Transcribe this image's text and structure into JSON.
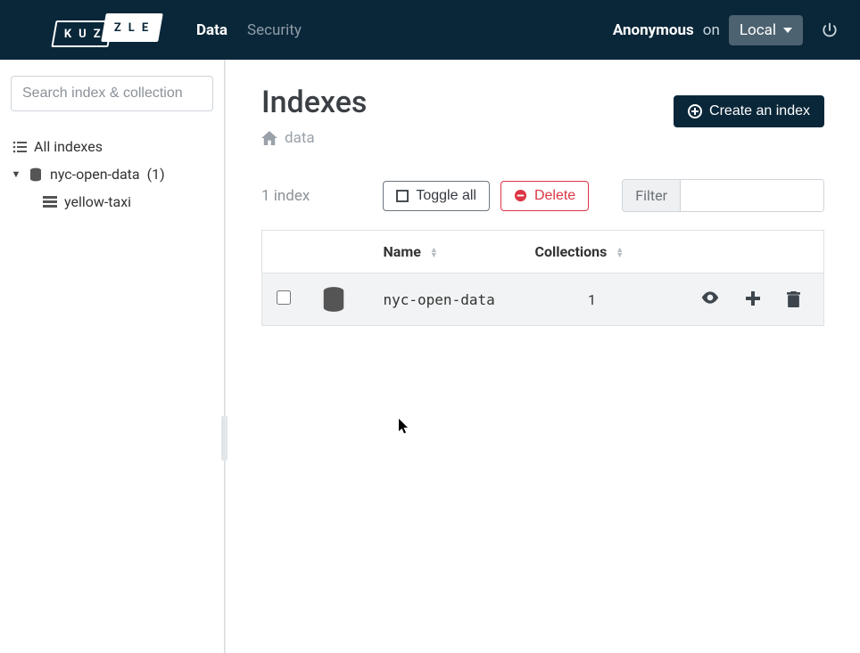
{
  "brand": {
    "left": "KUZ",
    "right": "ZLE"
  },
  "nav": {
    "data": "Data",
    "security": "Security"
  },
  "user": {
    "name": "Anonymous",
    "on": "on"
  },
  "env": {
    "label": "Local"
  },
  "sidebar": {
    "search_placeholder": "Search index & collection",
    "all_label": "All indexes",
    "index": {
      "name": "nyc-open-data",
      "count_suffix": "(1)"
    },
    "collection": {
      "name": "yellow-taxi"
    }
  },
  "page": {
    "title": "Indexes",
    "breadcrumb": "data",
    "create_label": "Create an index"
  },
  "toolbar": {
    "count": "1 index",
    "toggle_all": "Toggle all",
    "delete": "Delete",
    "filter_label": "Filter"
  },
  "table": {
    "headers": {
      "name": "Name",
      "collections": "Collections"
    },
    "rows": [
      {
        "name": "nyc-open-data",
        "collections": "1"
      }
    ]
  }
}
